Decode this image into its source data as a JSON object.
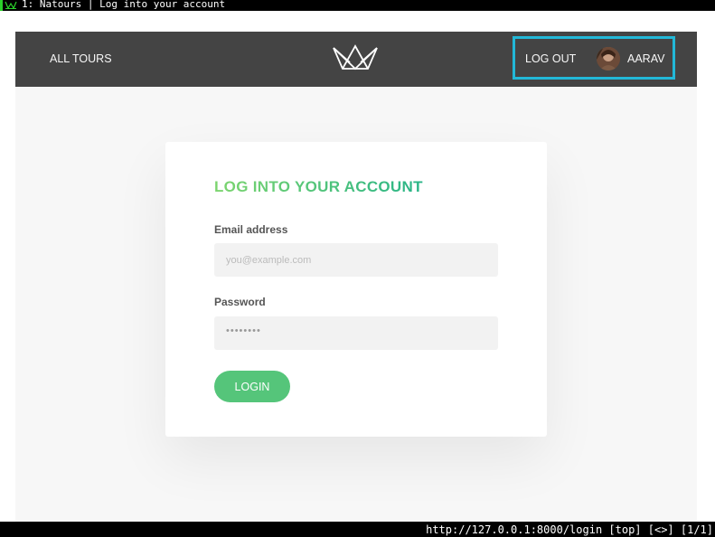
{
  "browser": {
    "tab_title": "1: Natours | Log into your account",
    "status_url": "http://127.0.0.1:8000/login [top] [<>] [1/1]"
  },
  "navbar": {
    "all_tours_label": "ALL TOURS",
    "logout_label": "LOG OUT",
    "user_name": "AARAV"
  },
  "login_form": {
    "heading": "LOG INTO YOUR ACCOUNT",
    "email_label": "Email address",
    "email_placeholder": "you@example.com",
    "email_value": "",
    "password_label": "Password",
    "password_mask": "••••••••",
    "submit_label": "LOGIN"
  },
  "colors": {
    "nav_background": "#444444",
    "accent_green": "#55c57a",
    "highlight_box": "#22b8d8",
    "page_background": "#f7f7f7"
  },
  "icons": {
    "logo": "natours-crown-logo",
    "favicon": "natours-favicon"
  }
}
